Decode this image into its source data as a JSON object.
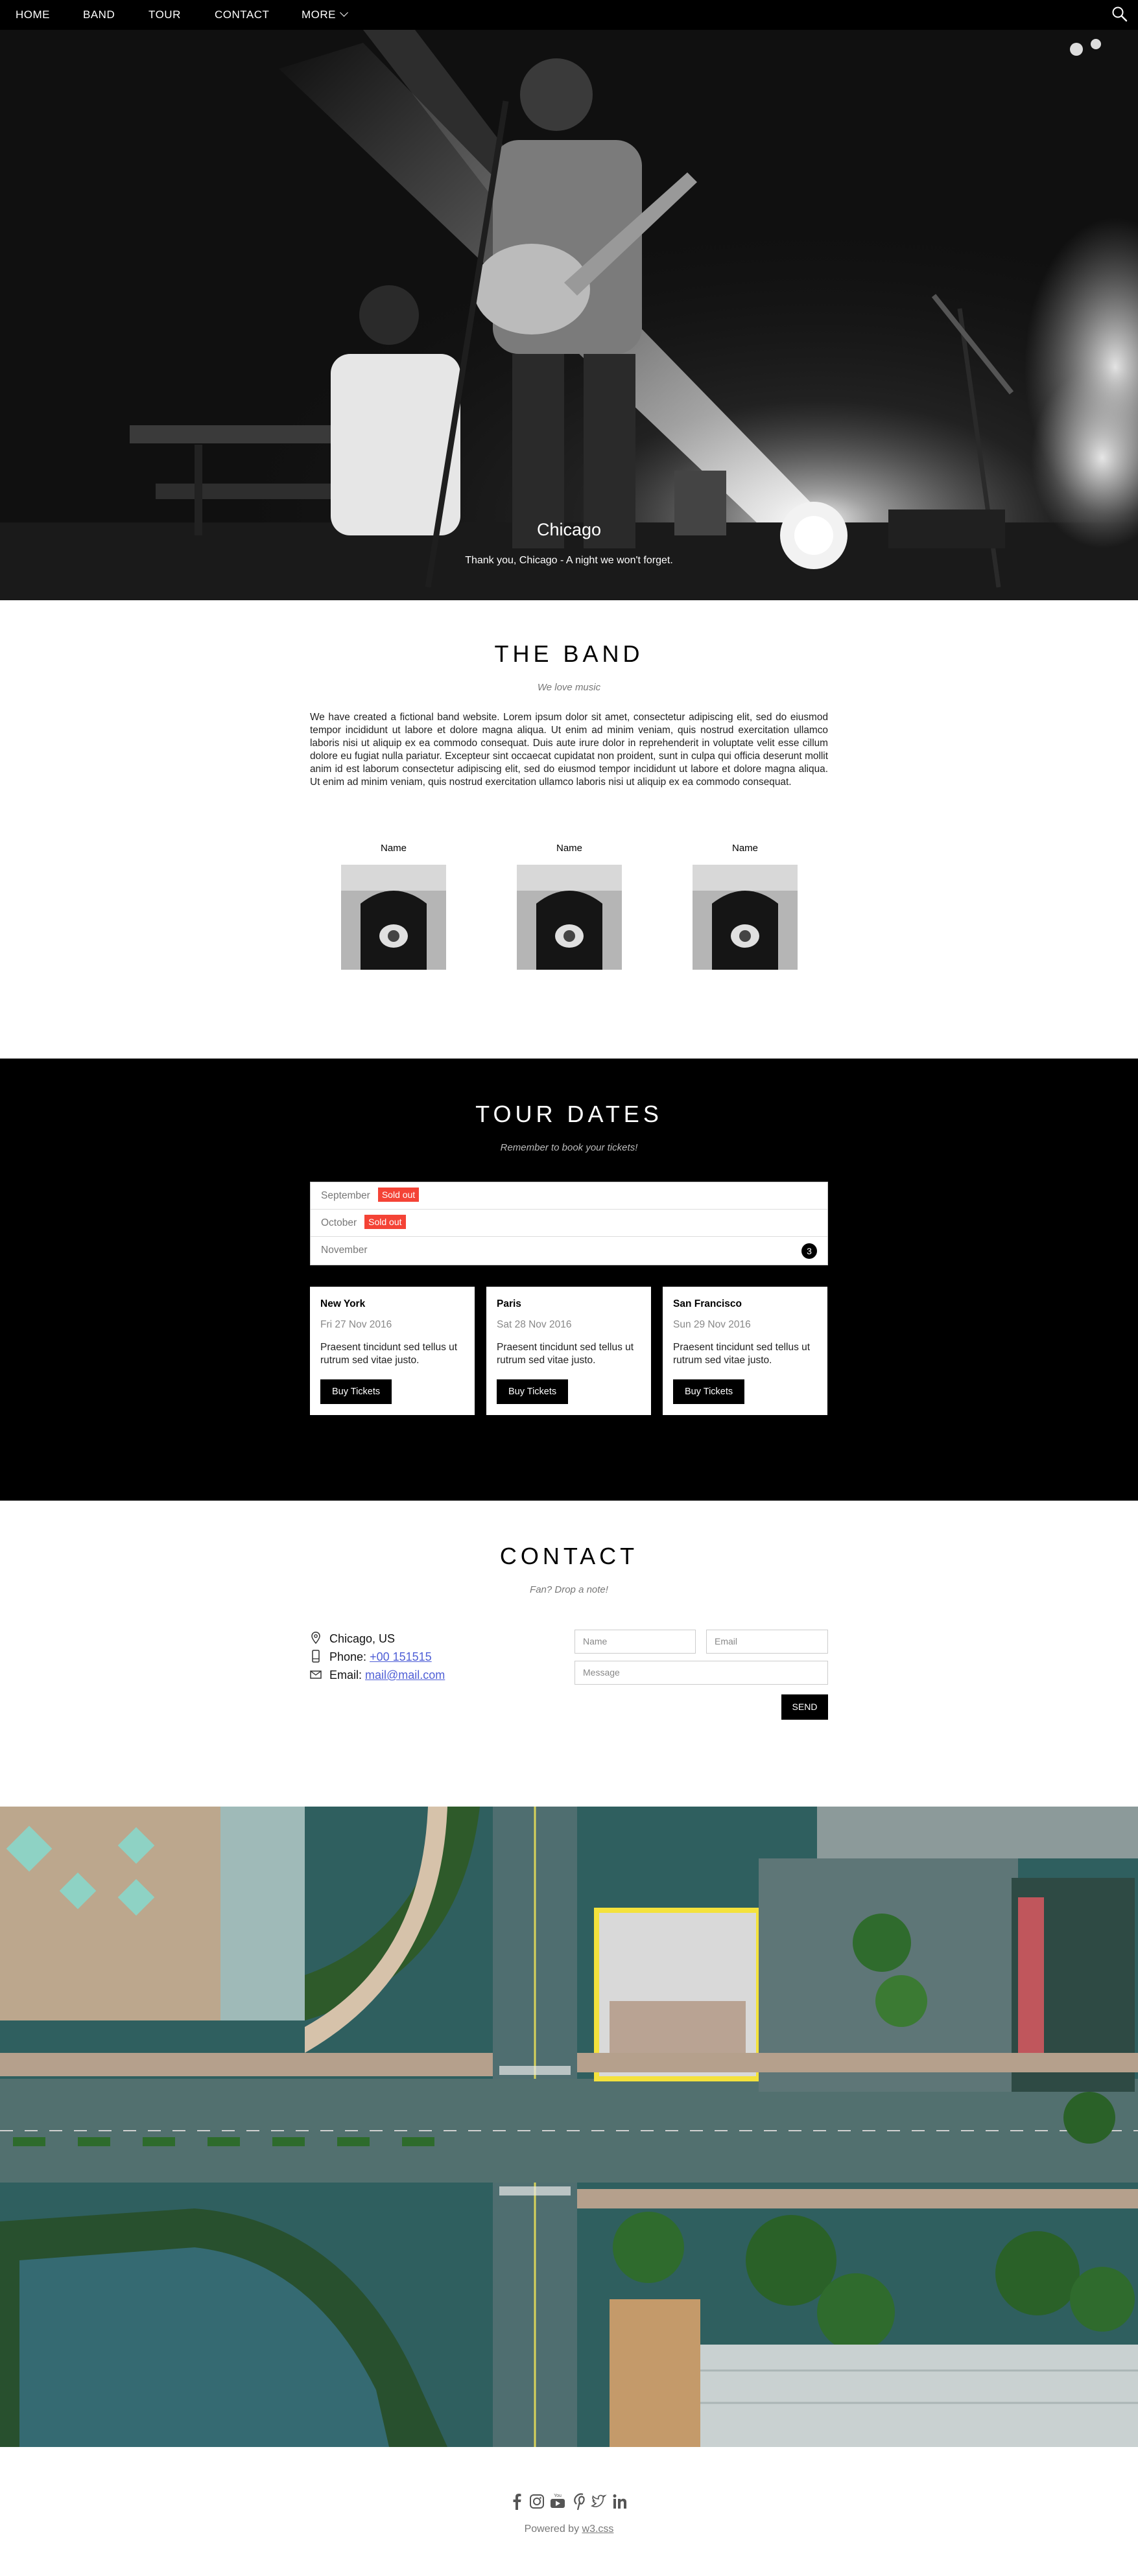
{
  "nav": {
    "items": [
      "HOME",
      "BAND",
      "TOUR",
      "CONTACT"
    ],
    "more_label": "MORE",
    "search_icon": "search-icon"
  },
  "hero": {
    "title": "Chicago",
    "subtitle": "Thank you, Chicago - A night we won't forget."
  },
  "band": {
    "title": "THE BAND",
    "subtitle": "We love music",
    "text": "We have created a fictional band website. Lorem ipsum dolor sit amet, consectetur adipiscing elit, sed do eiusmod tempor incididunt ut labore et dolore magna aliqua. Ut enim ad minim veniam, quis nostrud exercitation ullamco laboris nisi ut aliquip ex ea commodo consequat. Duis aute irure dolor in reprehenderit in voluptate velit esse cillum dolore eu fugiat nulla pariatur. Excepteur sint occaecat cupidatat non proident, sunt in culpa qui officia deserunt mollit anim id est laborum consectetur adipiscing elit, sed do eiusmod tempor incididunt ut labore et dolore magna aliqua. Ut enim ad minim veniam, quis nostrud exercitation ullamco laboris nisi ut aliquip ex ea commodo consequat.",
    "members": [
      {
        "name": "Name"
      },
      {
        "name": "Name"
      },
      {
        "name": "Name"
      }
    ]
  },
  "tour": {
    "title": "TOUR DATES",
    "subtitle": "Remember to book your tickets!",
    "months": [
      {
        "label": "September",
        "badge": "Sold out"
      },
      {
        "label": "October",
        "badge": "Sold out"
      },
      {
        "label": "November",
        "count": "3"
      }
    ],
    "cards": [
      {
        "city": "New York",
        "date": "Fri 27 Nov 2016",
        "desc": "Praesent tincidunt sed tellus ut rutrum sed vitae justo.",
        "button": "Buy Tickets"
      },
      {
        "city": "Paris",
        "date": "Sat 28 Nov 2016",
        "desc": "Praesent tincidunt sed tellus ut rutrum sed vitae justo.",
        "button": "Buy Tickets"
      },
      {
        "city": "San Francisco",
        "date": "Sun 29 Nov 2016",
        "desc": "Praesent tincidunt sed tellus ut rutrum sed vitae justo.",
        "button": "Buy Tickets"
      }
    ],
    "colors": {
      "sold_out": "#f44336",
      "background": "#000000"
    }
  },
  "contact": {
    "title": "CONTACT",
    "subtitle": "Fan? Drop a note!",
    "location": "Chicago, US",
    "phone_label": "Phone: ",
    "phone": "+00 151515",
    "email_label": "Email: ",
    "email": "mail@mail.com",
    "form": {
      "name_placeholder": "Name",
      "email_placeholder": "Email",
      "message_placeholder": "Message",
      "send_label": "SEND"
    },
    "link_color": "#4f5fd6"
  },
  "footer": {
    "social_icons": [
      "facebook-icon",
      "instagram-icon",
      "youtube-icon",
      "pinterest-icon",
      "twitter-icon",
      "linkedin-icon"
    ],
    "powered_prefix": "Powered by ",
    "powered_link": "w3.css"
  }
}
